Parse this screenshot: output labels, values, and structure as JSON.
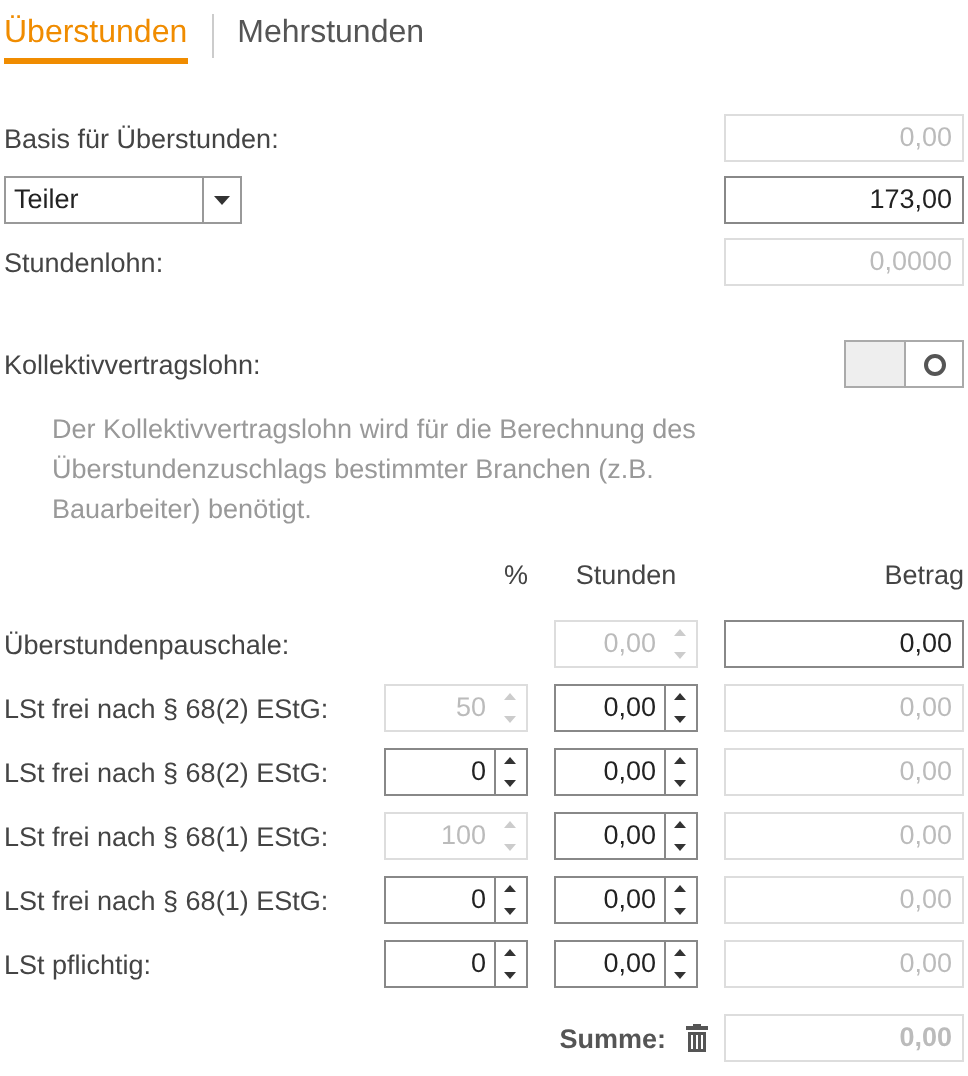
{
  "tabs": [
    {
      "label": "Überstunden",
      "selected": true
    },
    {
      "label": "Mehrstunden",
      "selected": false
    }
  ],
  "basis": {
    "label": "Basis für Überstunden:",
    "value": "0,00",
    "disabled": true
  },
  "divisor": {
    "select": "Teiler",
    "value": "173,00",
    "disabled": false
  },
  "hourly_wage": {
    "label": "Stundenlohn:",
    "value": "0,0000",
    "disabled": true
  },
  "collective_wage": {
    "label": "Kollektivvertragslohn:",
    "on": false,
    "description": "Der Kollektivvertragslohn wird für die Berechnung des Überstundenzuschlags bestimmter Branchen (z.B. Bauarbeiter) benötigt."
  },
  "columns": [
    "%",
    "Stunden",
    "Betrag"
  ],
  "rows": [
    {
      "label": "Überstundenpauschale:",
      "hours": {
        "value": "0,00",
        "disabled": true
      },
      "amount": {
        "value": "0,00",
        "disabled": false
      }
    },
    {
      "label": "LSt frei nach § 68(2) EStG:",
      "percent": {
        "value": "50",
        "disabled": true
      },
      "hours": {
        "value": "0,00",
        "disabled": false
      },
      "amount": {
        "value": "0,00",
        "disabled": true
      }
    },
    {
      "label": "LSt frei nach § 68(2) EStG:",
      "percent": {
        "value": "0",
        "disabled": false
      },
      "hours": {
        "value": "0,00",
        "disabled": false
      },
      "amount": {
        "value": "0,00",
        "disabled": true
      }
    },
    {
      "label": "LSt frei nach § 68(1) EStG:",
      "percent": {
        "value": "100",
        "disabled": true
      },
      "hours": {
        "value": "0,00",
        "disabled": false
      },
      "amount": {
        "value": "0,00",
        "disabled": true
      }
    },
    {
      "label": "LSt frei nach § 68(1) EStG:",
      "percent": {
        "value": "0",
        "disabled": false
      },
      "hours": {
        "value": "0,00",
        "disabled": false
      },
      "amount": {
        "value": "0,00",
        "disabled": true
      }
    },
    {
      "label": "LSt pflichtig:",
      "percent": {
        "value": "0",
        "disabled": false
      },
      "hours": {
        "value": "0,00",
        "disabled": false
      },
      "amount": {
        "value": "0,00",
        "disabled": true
      }
    }
  ],
  "sum": {
    "label": "Summe:",
    "value": "0,00",
    "disabled": true
  }
}
